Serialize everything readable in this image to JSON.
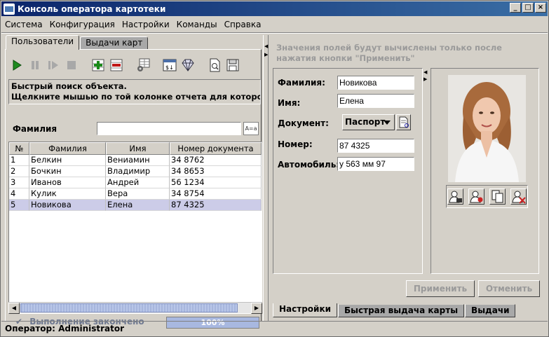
{
  "window": {
    "title": "Консоль оператора картотеки"
  },
  "menu": [
    "Система",
    "Конфигурация",
    "Настройки",
    "Команды",
    "Справка"
  ],
  "left_tabs": [
    "Пользователи",
    "Выдачи карт"
  ],
  "hint": {
    "line1": "Быстрый поиск объекта.",
    "line2": "Щелкните мышью по той колонке отчета для которой буде..."
  },
  "filter": {
    "label": "Фамилия",
    "value": "",
    "button": "A=a"
  },
  "table": {
    "columns": [
      "№",
      "Фамилия",
      "Имя",
      "Номер документа"
    ],
    "rows": [
      [
        "1",
        "Белкин",
        "Вениамин",
        "34 8762"
      ],
      [
        "2",
        "Бочкин",
        "Владимир",
        "34 8653"
      ],
      [
        "3",
        "Иванов",
        "Андрей",
        "56 1234"
      ],
      [
        "4",
        "Кулик",
        "Вера",
        "34 8754"
      ],
      [
        "5",
        "Новикова",
        "Елена",
        "87 4325"
      ]
    ],
    "selected_row": 5
  },
  "status": {
    "done_text": "Выполнение закончено",
    "progress_text": "100%",
    "progress_value": 1.0
  },
  "right": {
    "note": "Значения полей будут вычислены только после нажатия кнопки \"Применить\"",
    "fields": {
      "surname_label": "Фамилия:",
      "surname": "Новикова",
      "name_label": "Имя:",
      "name": "Елена",
      "doc_label": "Документ:",
      "doc": "Паспорт",
      "number_label": "Номер:",
      "number": "87 4325",
      "car_label": "Автомобиль:",
      "car": "у 563 мм 97"
    },
    "apply": "Применить",
    "cancel": "Отменить",
    "bottom_tabs": [
      "Настройки",
      "Быстрая выдача карты",
      "Выдачи"
    ]
  },
  "statusbar": "Оператор: Administrator",
  "colors": {
    "title_start": "#0a246a",
    "title_end": "#3a6ea5",
    "selected_row": "#cccce8",
    "progress": "#a8b8e0"
  }
}
